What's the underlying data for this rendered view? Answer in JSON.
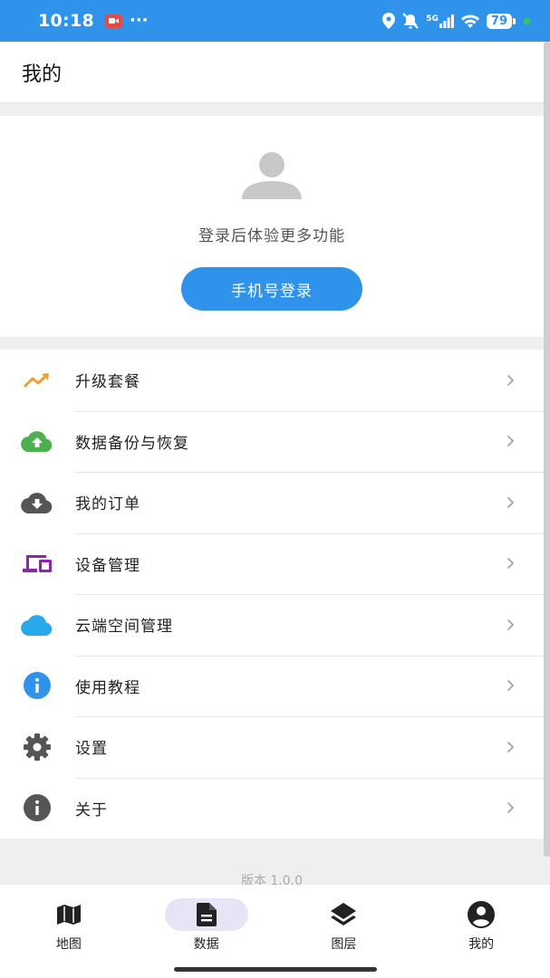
{
  "status_bar": {
    "time": "10:18",
    "dots": "···",
    "network": "5G",
    "battery": "79"
  },
  "header": {
    "title": "我的"
  },
  "profile": {
    "hint": "登录后体验更多功能",
    "login_button": "手机号登录"
  },
  "menu": [
    {
      "label": "升级套餐",
      "icon": "trending-up-icon",
      "color": "#f0a030"
    },
    {
      "label": "数据备份与恢复",
      "icon": "cloud-upload-icon",
      "color": "#4caf50"
    },
    {
      "label": "我的订单",
      "icon": "cloud-download-icon",
      "color": "#555555"
    },
    {
      "label": "设备管理",
      "icon": "devices-icon",
      "color": "#8e24aa"
    },
    {
      "label": "云端空间管理",
      "icon": "cloud-icon",
      "color": "#29a8ec"
    },
    {
      "label": "使用教程",
      "icon": "info-icon",
      "color": "#2f93ec"
    },
    {
      "label": "设置",
      "icon": "gear-icon",
      "color": "#555555"
    },
    {
      "label": "关于",
      "icon": "info-icon",
      "color": "#555555"
    }
  ],
  "version": "版本 1.0.0",
  "bottom_nav": [
    {
      "label": "地图",
      "icon": "map-icon"
    },
    {
      "label": "数据",
      "icon": "document-icon",
      "active": true
    },
    {
      "label": "图层",
      "icon": "layers-icon"
    },
    {
      "label": "我的",
      "icon": "account-icon"
    }
  ],
  "colors": {
    "primary": "#2f93ec",
    "active_pill": "#e9e4f5"
  }
}
